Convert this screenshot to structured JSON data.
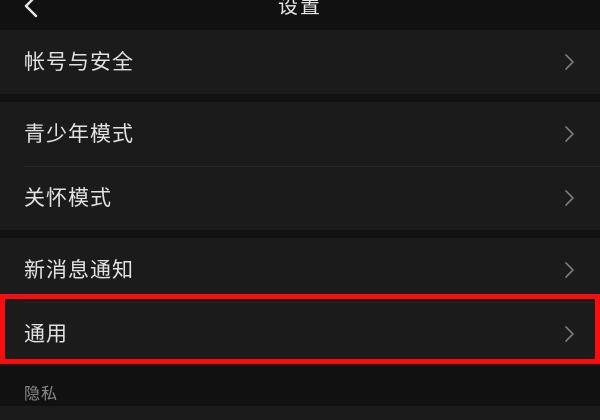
{
  "header": {
    "title": "设置",
    "back_icon": "chevron-left-icon"
  },
  "groups": [
    {
      "items": [
        {
          "label": "帐号与安全",
          "icon": "chevron-right-icon"
        }
      ]
    },
    {
      "items": [
        {
          "label": "青少年模式",
          "icon": "chevron-right-icon"
        },
        {
          "label": "关怀模式",
          "icon": "chevron-right-icon"
        }
      ]
    },
    {
      "items": [
        {
          "label": "新消息通知",
          "icon": "chevron-right-icon"
        },
        {
          "label": "通用",
          "icon": "chevron-right-icon",
          "highlighted": true
        }
      ]
    }
  ],
  "section_privacy": {
    "label": "隐私"
  },
  "colors": {
    "background": "#111111",
    "row": "#1b1b1b",
    "text": "#e2e2e2",
    "chevron": "#7a7a7a",
    "highlight": "#f70d0d"
  }
}
